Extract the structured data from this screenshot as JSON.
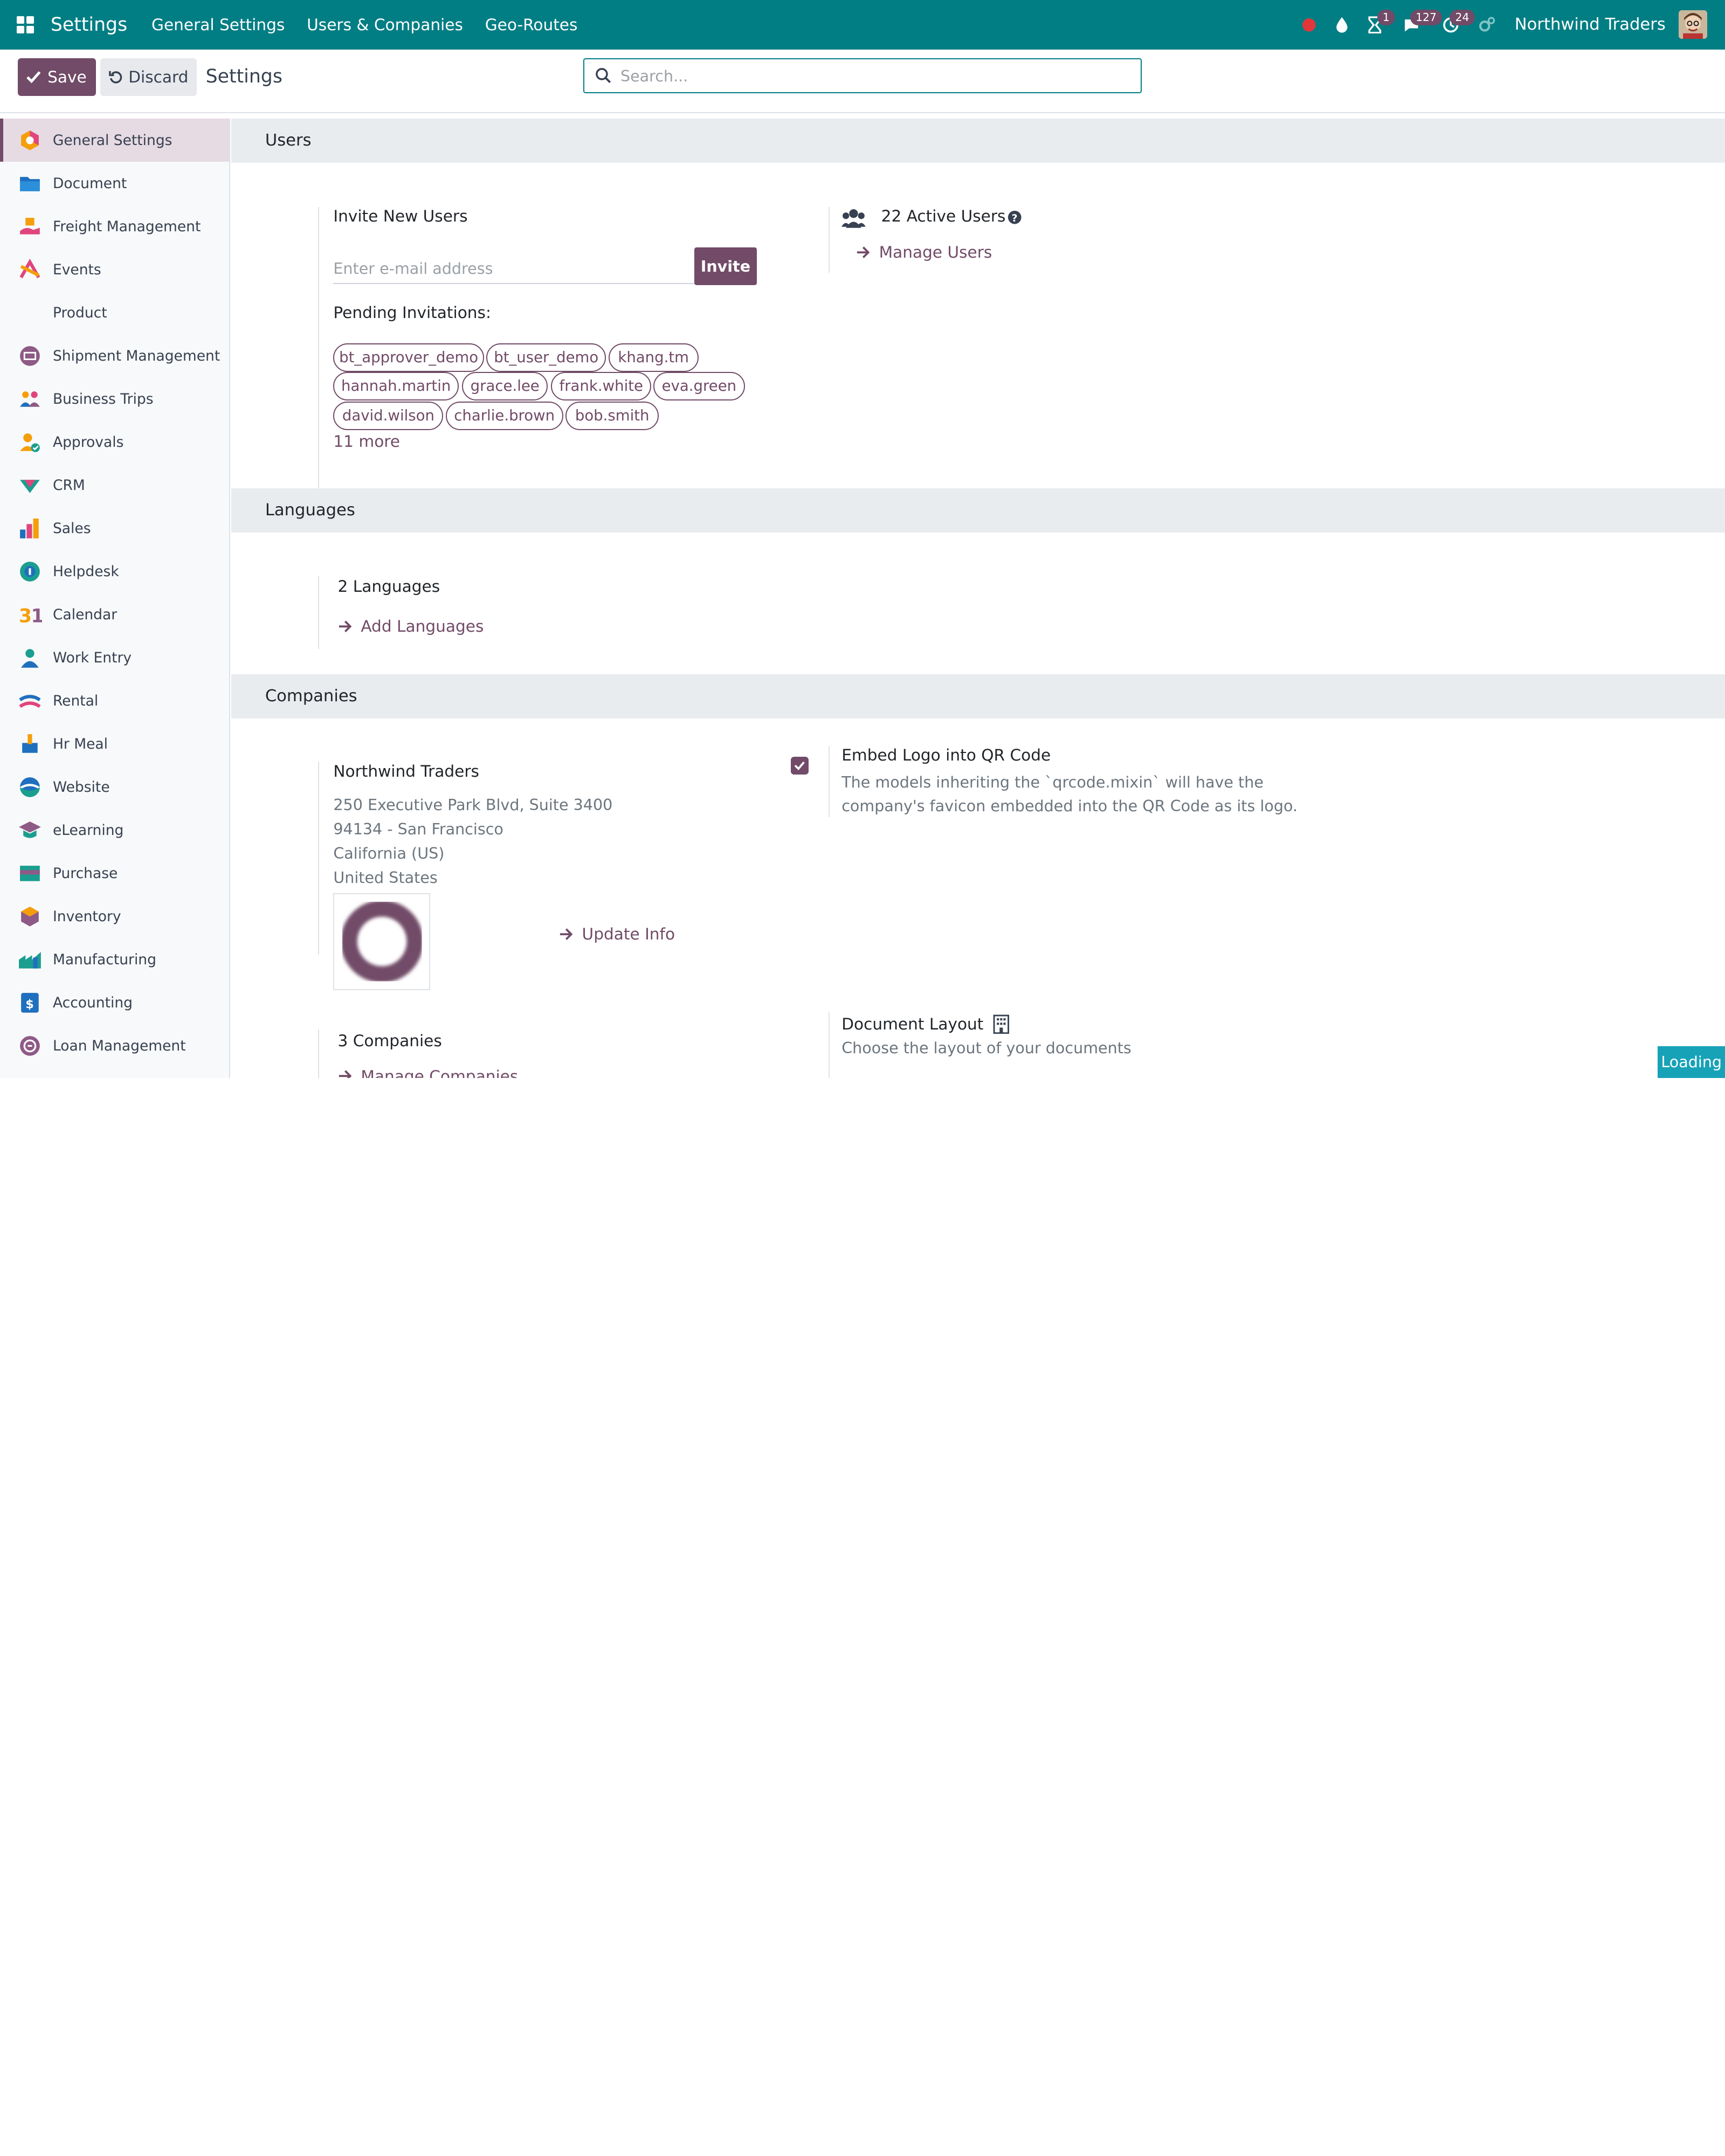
{
  "navbar": {
    "brand": "Settings",
    "menu": [
      "General Settings",
      "Users & Companies",
      "Geo-Routes"
    ],
    "badges": {
      "activity": "1",
      "messages": "127",
      "timers": "24"
    },
    "company": "Northwind Traders",
    "colors": {
      "bar": "#017e84",
      "accent": "#714b67"
    }
  },
  "control": {
    "save": "Save",
    "discard": "Discard",
    "title": "Settings",
    "search_placeholder": "Search..."
  },
  "sidebar": {
    "items": [
      {
        "label": "General Settings",
        "icon": "settings-app-icon"
      },
      {
        "label": "Document",
        "icon": "folder-icon"
      },
      {
        "label": "Freight Management",
        "icon": "freight-icon"
      },
      {
        "label": "Events",
        "icon": "events-icon"
      },
      {
        "label": "Product",
        "icon": ""
      },
      {
        "label": "Shipment Management",
        "icon": "shipment-icon"
      },
      {
        "label": "Business Trips",
        "icon": "business-trips-icon"
      },
      {
        "label": "Approvals",
        "icon": "approvals-icon"
      },
      {
        "label": "CRM",
        "icon": "crm-icon"
      },
      {
        "label": "Sales",
        "icon": "sales-icon"
      },
      {
        "label": "Helpdesk",
        "icon": "helpdesk-icon"
      },
      {
        "label": "Calendar",
        "icon": "calendar-icon"
      },
      {
        "label": "Work Entry",
        "icon": "work-entry-icon"
      },
      {
        "label": "Rental",
        "icon": "rental-icon"
      },
      {
        "label": "Hr Meal",
        "icon": "hr-meal-icon"
      },
      {
        "label": "Website",
        "icon": "website-icon"
      },
      {
        "label": "eLearning",
        "icon": "elearning-icon"
      },
      {
        "label": "Purchase",
        "icon": "purchase-icon"
      },
      {
        "label": "Inventory",
        "icon": "inventory-icon"
      },
      {
        "label": "Manufacturing",
        "icon": "manufacturing-icon"
      },
      {
        "label": "Accounting",
        "icon": "accounting-icon"
      },
      {
        "label": "Loan Management",
        "icon": "loan-icon"
      }
    ]
  },
  "users": {
    "heading": "Users",
    "invite_label": "Invite New Users",
    "email_placeholder": "Enter e-mail address",
    "invite_button": "Invite",
    "pending_label": "Pending Invitations:",
    "pending": [
      "bt_approver_demo",
      "bt_user_demo",
      "khang.tm",
      "hannah.martin",
      "grace.lee",
      "frank.white",
      "eva.green",
      "david.wilson",
      "charlie.brown",
      "bob.smith"
    ],
    "more": "11 more",
    "active_users": "22 Active Users",
    "manage_users": "Manage Users"
  },
  "languages": {
    "heading": "Languages",
    "count": "2 Languages",
    "add": "Add Languages"
  },
  "companies": {
    "heading": "Companies",
    "name": "Northwind Traders",
    "address": [
      "250 Executive Park Blvd, Suite 3400",
      "94134 - San Francisco",
      "California (US)",
      "United States"
    ],
    "update": "Update Info",
    "embed_title": "Embed Logo into QR Code",
    "embed_desc_1": "The models inheriting the `qrcode.mixin` will have the",
    "embed_desc_2": "company's favicon embedded into the QR Code as its logo.",
    "embed_checked": true,
    "count": "3 Companies",
    "manage": "Manage Companies",
    "doc_layout_title": "Document Layout",
    "doc_layout_desc": "Choose the layout of your documents"
  },
  "status": {
    "loading": "Loading"
  }
}
